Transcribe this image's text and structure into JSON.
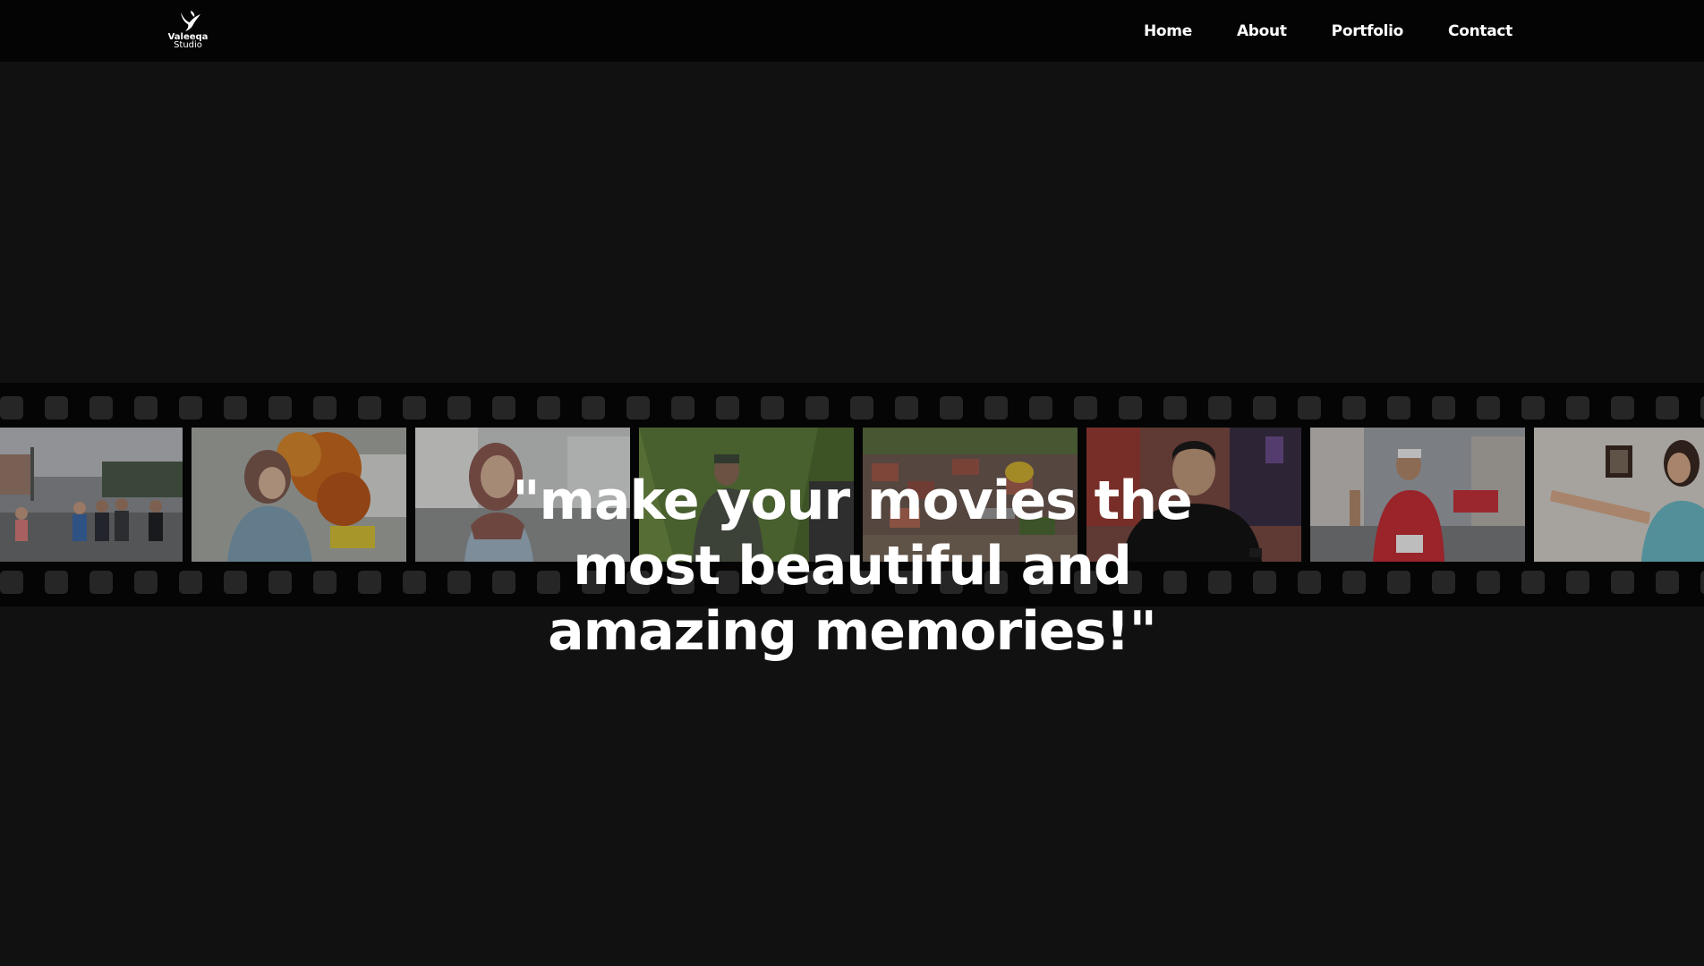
{
  "brand": {
    "logo_line1": "Valeeqa",
    "logo_line2": "Studio"
  },
  "nav": {
    "items": [
      {
        "label": "Home"
      },
      {
        "label": "About"
      },
      {
        "label": "Portfolio"
      },
      {
        "label": "Contact"
      }
    ]
  },
  "hero": {
    "quote_line1": "\"make your movies the",
    "quote_line2": "most beautiful and",
    "quote_line3": "amazing memories!\""
  },
  "colors": {
    "background": "#111111",
    "navbar": "#040404",
    "film_strip": "#050505",
    "sprocket": "#262626",
    "text": "#ffffff"
  },
  "filmstrip": {
    "frames": [
      {
        "icon": "runners-photo-icon"
      },
      {
        "icon": "woman-autumn-photo-icon"
      },
      {
        "icon": "smiling-woman-photo-icon"
      },
      {
        "icon": "man-garden-photo-icon"
      },
      {
        "icon": "aerial-town-photo-icon"
      },
      {
        "icon": "man-smartwatch-photo-icon"
      },
      {
        "icon": "marathon-runner-photo-icon"
      },
      {
        "icon": "woman-exercise-photo-icon"
      }
    ]
  }
}
